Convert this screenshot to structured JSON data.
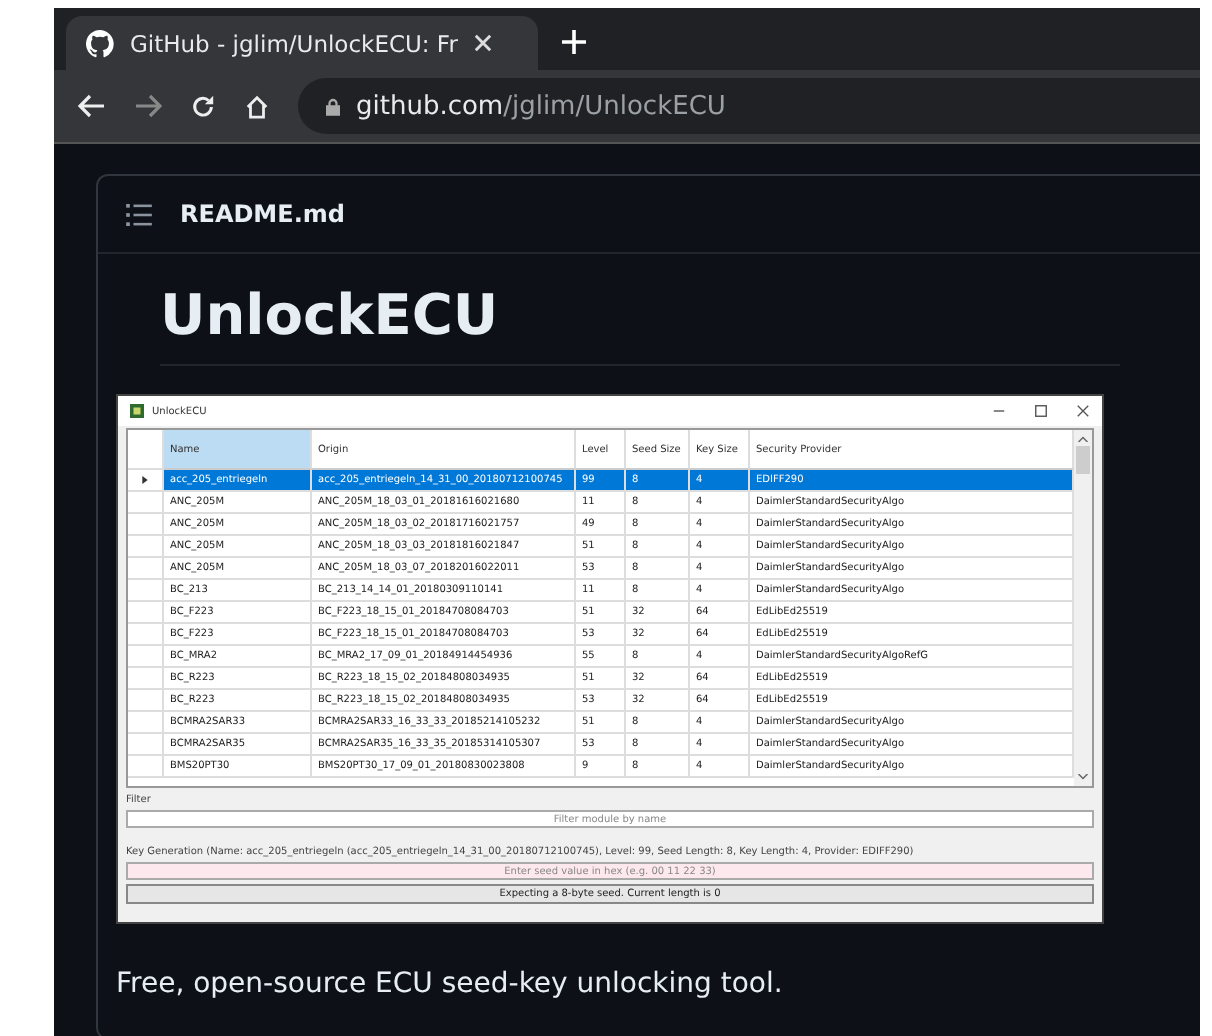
{
  "browser": {
    "tab_title": "GitHub - jglim/UnlockECU: Fr",
    "url_host": "github.com",
    "url_path": "/jglim/UnlockECU"
  },
  "readme": {
    "file_name": "README.md",
    "heading": "UnlockECU",
    "description": "Free, open-source ECU seed-key unlocking tool."
  },
  "app": {
    "title": "UnlockECU",
    "columns": [
      {
        "label": "Name",
        "selected": true
      },
      {
        "label": "Origin",
        "selected": false
      },
      {
        "label": "Level",
        "selected": false
      },
      {
        "label": "Seed Size",
        "selected": false
      },
      {
        "label": "Key Size",
        "selected": false
      },
      {
        "label": "Security Provider",
        "selected": false
      }
    ],
    "rows": [
      {
        "selected": true,
        "cells": [
          "acc_205_entriegeln",
          "acc_205_entriegeln_14_31_00_20180712100745",
          "99",
          "8",
          "4",
          "EDIFF290"
        ]
      },
      {
        "selected": false,
        "cells": [
          "ANC_205M",
          "ANC_205M_18_03_01_20181616021680",
          "11",
          "8",
          "4",
          "DaimlerStandardSecurityAlgo"
        ]
      },
      {
        "selected": false,
        "cells": [
          "ANC_205M",
          "ANC_205M_18_03_02_20181716021757",
          "49",
          "8",
          "4",
          "DaimlerStandardSecurityAlgo"
        ]
      },
      {
        "selected": false,
        "cells": [
          "ANC_205M",
          "ANC_205M_18_03_03_20181816021847",
          "51",
          "8",
          "4",
          "DaimlerStandardSecurityAlgo"
        ]
      },
      {
        "selected": false,
        "cells": [
          "ANC_205M",
          "ANC_205M_18_03_07_20182016022011",
          "53",
          "8",
          "4",
          "DaimlerStandardSecurityAlgo"
        ]
      },
      {
        "selected": false,
        "cells": [
          "BC_213",
          "BC_213_14_14_01_20180309110141",
          "11",
          "8",
          "4",
          "DaimlerStandardSecurityAlgo"
        ]
      },
      {
        "selected": false,
        "cells": [
          "BC_F223",
          "BC_F223_18_15_01_20184708084703",
          "51",
          "32",
          "64",
          "EdLibEd25519"
        ]
      },
      {
        "selected": false,
        "cells": [
          "BC_F223",
          "BC_F223_18_15_01_20184708084703",
          "53",
          "32",
          "64",
          "EdLibEd25519"
        ]
      },
      {
        "selected": false,
        "cells": [
          "BC_MRA2",
          "BC_MRA2_17_09_01_20184914454936",
          "55",
          "8",
          "4",
          "DaimlerStandardSecurityAlgoRefG"
        ]
      },
      {
        "selected": false,
        "cells": [
          "BC_R223",
          "BC_R223_18_15_02_20184808034935",
          "51",
          "32",
          "64",
          "EdLibEd25519"
        ]
      },
      {
        "selected": false,
        "cells": [
          "BC_R223",
          "BC_R223_18_15_02_20184808034935",
          "53",
          "32",
          "64",
          "EdLibEd25519"
        ]
      },
      {
        "selected": false,
        "cells": [
          "BCMRA2SAR33",
          "BCMRA2SAR33_16_33_33_20185214105232",
          "51",
          "8",
          "4",
          "DaimlerStandardSecurityAlgo"
        ]
      },
      {
        "selected": false,
        "cells": [
          "BCMRA2SAR35",
          "BCMRA2SAR35_16_33_35_20185314105307",
          "53",
          "8",
          "4",
          "DaimlerStandardSecurityAlgo"
        ]
      },
      {
        "selected": false,
        "cells": [
          "BMS20PT30",
          "BMS20PT30_17_09_01_20180830023808",
          "9",
          "8",
          "4",
          "DaimlerStandardSecurityAlgo"
        ]
      }
    ],
    "filter_label": "Filter",
    "filter_placeholder": "Filter module by name",
    "keygen_label": "Key Generation (Name: acc_205_entriegeln (acc_205_entriegeln_14_31_00_20180712100745), Level: 99, Seed Length: 8, Key Length: 4, Provider: EDIFF290)",
    "seed_placeholder": "Enter seed value in hex (e.g. 00 11 22 33)",
    "status_button": "Expecting a 8-byte seed. Current length is 0"
  }
}
